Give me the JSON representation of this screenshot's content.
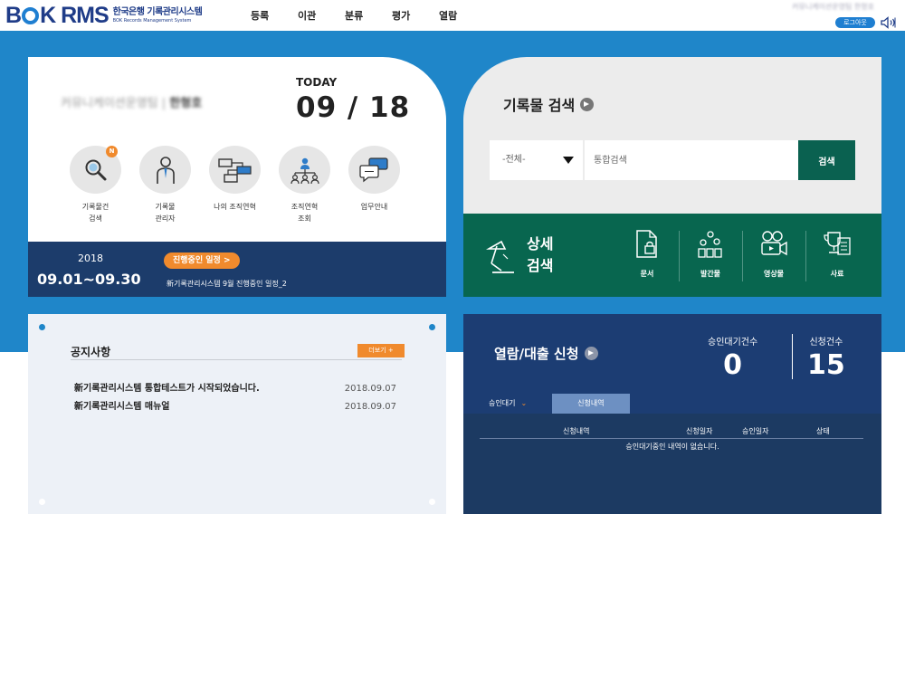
{
  "header": {
    "logo_main_pre": "B",
    "logo_main_post": "K RMS",
    "logo_sub_ko": "한국은행 기록관리시스템",
    "logo_sub_en": "BOK Records Management System",
    "nav": [
      "등록",
      "이관",
      "분류",
      "평가",
      "열람"
    ],
    "user_info": "커뮤니케이션운영팀 한형호",
    "logout_label": "로그아웃"
  },
  "profile": {
    "dept": "커뮤니케이션운영팀",
    "name": "한형호",
    "today_label": "TODAY",
    "today_date": "09 / 18",
    "quick_menu": [
      {
        "label": "기록물건\n검색",
        "icon": "search-icon",
        "badge": "N"
      },
      {
        "label": "기록물\n관리자",
        "icon": "manager-icon"
      },
      {
        "label": "나의 조직연혁",
        "icon": "org-history-icon"
      },
      {
        "label": "조직연혁\n조회",
        "icon": "org-chart-icon"
      },
      {
        "label": "업무안내",
        "icon": "chat-icon"
      }
    ],
    "schedule": {
      "year": "2018",
      "range": "09.01~09.30",
      "button_label": "진행중인 일정 >",
      "text": "新기록관리시스템 9월 진행중인 일정_2"
    }
  },
  "search": {
    "title": "기록물 검색",
    "select_value": "-전체-",
    "input_placeholder": "통합검색",
    "button_label": "검색",
    "detail_title": "상세\n검색",
    "detail_items": [
      {
        "label": "문서",
        "icon": "document-lock-icon"
      },
      {
        "label": "발간물",
        "icon": "publication-icon"
      },
      {
        "label": "영상물",
        "icon": "video-camera-icon"
      },
      {
        "label": "사료",
        "icon": "trophy-icon"
      }
    ]
  },
  "notice": {
    "title": "공지사항",
    "more_label": "더보기 +",
    "items": [
      {
        "text": "新기록관리시스템 통합테스트가 시작되었습니다.",
        "date": "2018.09.07"
      },
      {
        "text": "新기록관리시스템 매뉴얼",
        "date": "2018.09.07"
      }
    ]
  },
  "request": {
    "title": "열람/대출 신청",
    "pending_label": "승인대기건수",
    "pending_value": "0",
    "total_label": "신청건수",
    "total_value": "15",
    "tabs": [
      "승인대기",
      "신청내역"
    ],
    "columns": [
      "신청내역",
      "신청일자",
      "승인일자",
      "상태"
    ],
    "empty_message": "승인대기중인 내역이 없습니다."
  },
  "colors": {
    "brand_blue": "#1f86c9",
    "navy": "#1c3c6b",
    "green": "#08664f",
    "orange": "#f08a2d"
  }
}
